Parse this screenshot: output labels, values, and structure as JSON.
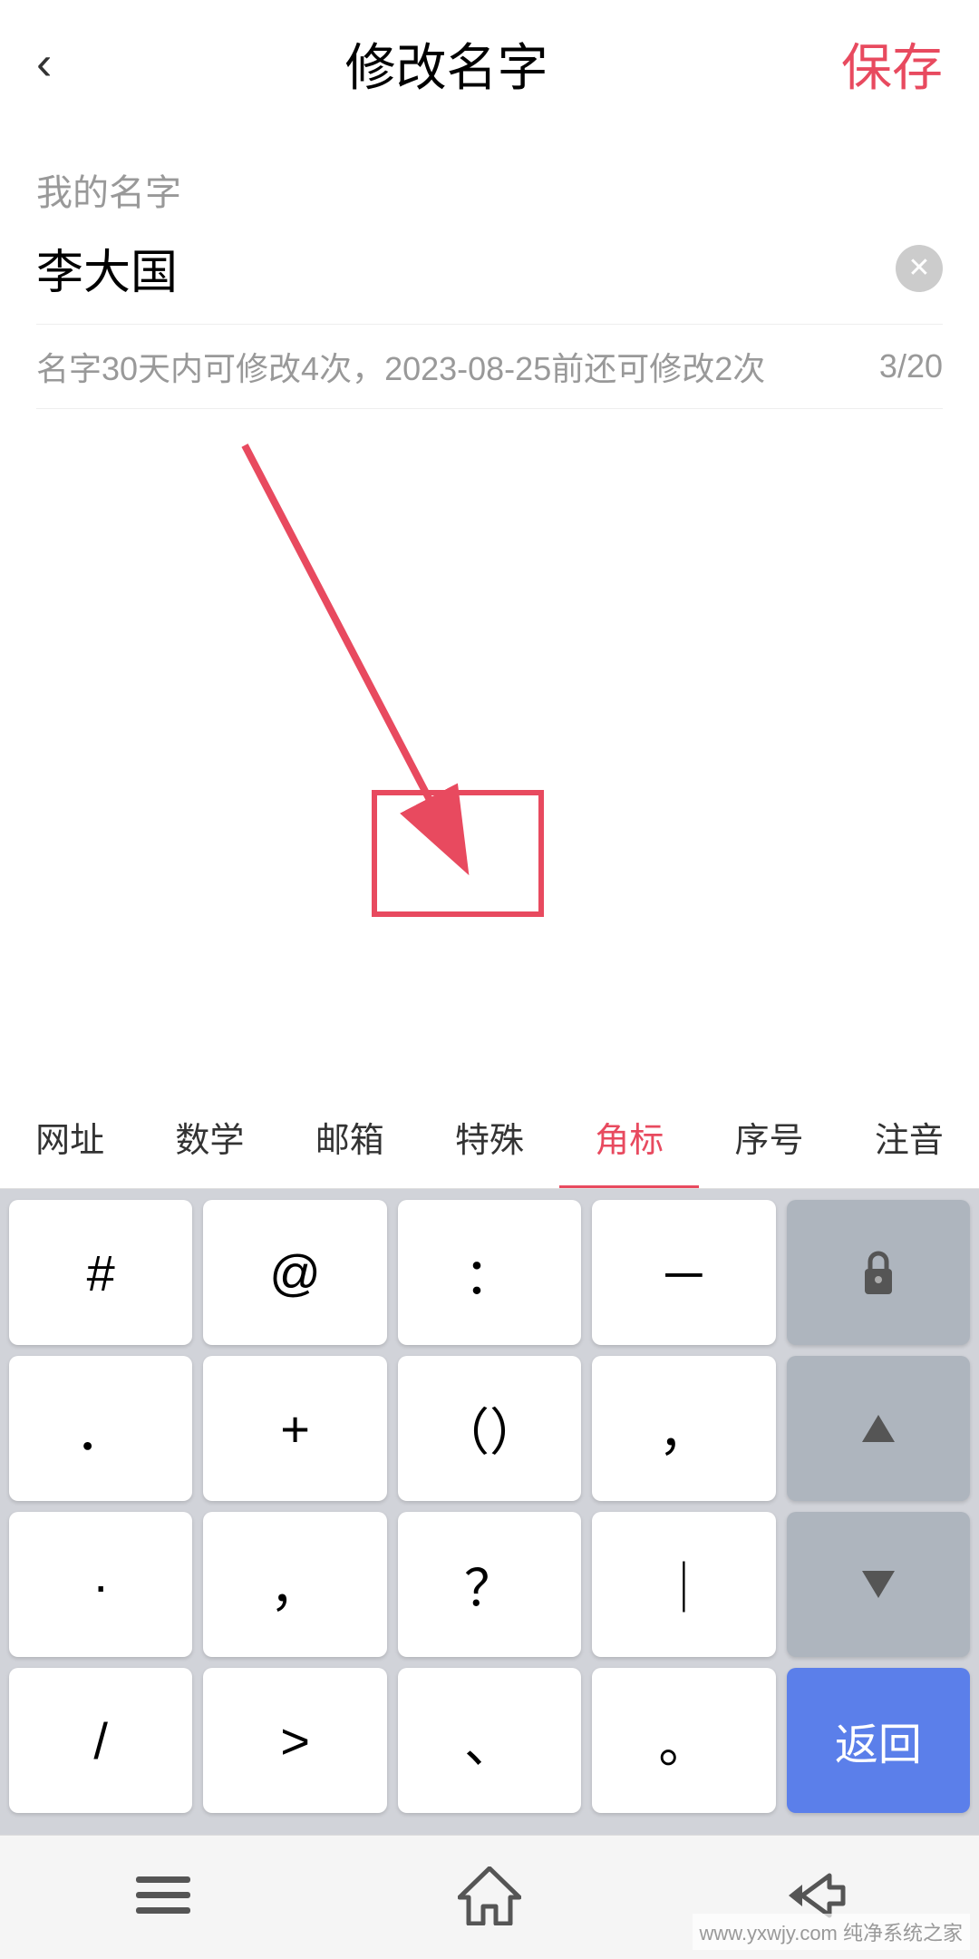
{
  "header": {
    "back_label": "‹",
    "title": "修改名字",
    "save_label": "保存"
  },
  "form": {
    "field_label": "我的名字",
    "field_value": "李大国",
    "hint_text": "名字30天内可修改4次，2023-08-25前还可修改2次",
    "count_text": "3/20"
  },
  "keyboard": {
    "categories": [
      {
        "label": "网址",
        "active": false
      },
      {
        "label": "数学",
        "active": false
      },
      {
        "label": "邮箱",
        "active": false
      },
      {
        "label": "特殊",
        "active": false
      },
      {
        "label": "角标",
        "active": true
      },
      {
        "label": "序号",
        "active": false
      },
      {
        "label": "注音",
        "active": false
      }
    ],
    "rows": [
      [
        {
          "label": "#",
          "type": "normal"
        },
        {
          "label": "@",
          "type": "normal"
        },
        {
          "label": "：",
          "type": "normal"
        },
        {
          "label": "－",
          "type": "normal"
        },
        {
          "label": "🔒",
          "type": "lock"
        }
      ],
      [
        {
          "label": "．",
          "type": "normal"
        },
        {
          "label": "+",
          "type": "normal"
        },
        {
          "label": "（）",
          "type": "normal"
        },
        {
          "label": "，",
          "type": "normal"
        },
        {
          "label": "▲",
          "type": "nav"
        }
      ],
      [
        {
          "label": "·",
          "type": "normal"
        },
        {
          "label": "，",
          "type": "normal"
        },
        {
          "label": "？",
          "type": "normal"
        },
        {
          "label": "｜",
          "type": "normal"
        },
        {
          "label": "▼",
          "type": "nav"
        }
      ],
      [
        {
          "label": "/",
          "type": "normal"
        },
        {
          "label": ">",
          "type": "normal"
        },
        {
          "label": "、",
          "type": "normal"
        },
        {
          "label": "。",
          "type": "normal"
        },
        {
          "label": "返回",
          "type": "action"
        }
      ]
    ]
  },
  "bottom_nav": {
    "menu_icon": "≡",
    "home_icon": "⌂",
    "back_icon": "↩"
  },
  "watermark": {
    "text": "www.yxwjy.com 纯净系统之家"
  }
}
